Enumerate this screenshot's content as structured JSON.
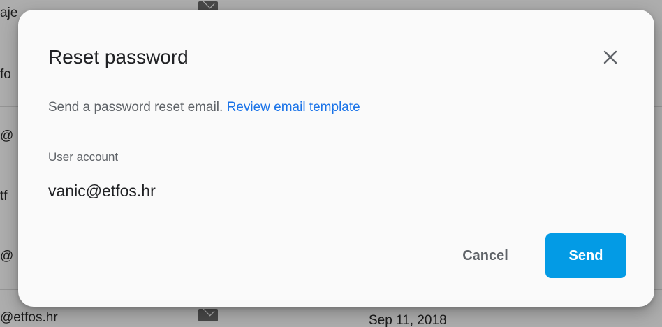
{
  "background": {
    "rows": [
      {
        "email": "aje"
      },
      {
        "email": "fo"
      },
      {
        "email": "@"
      },
      {
        "email": "tf"
      },
      {
        "email": "@"
      },
      {
        "email": "@etfos.hr",
        "date": "Sep 11, 2018"
      }
    ]
  },
  "dialog": {
    "title": "Reset password",
    "description": "Send a password reset email.",
    "template_link": "Review email template",
    "account_label": "User account",
    "account_value": "vanic@etfos.hr",
    "cancel_label": "Cancel",
    "send_label": "Send"
  },
  "colors": {
    "primary": "#039be5",
    "link": "#1a73e8",
    "dialog_bg": "#fafafa"
  },
  "icons": {
    "close": "close-icon",
    "mail": "mail-icon"
  }
}
